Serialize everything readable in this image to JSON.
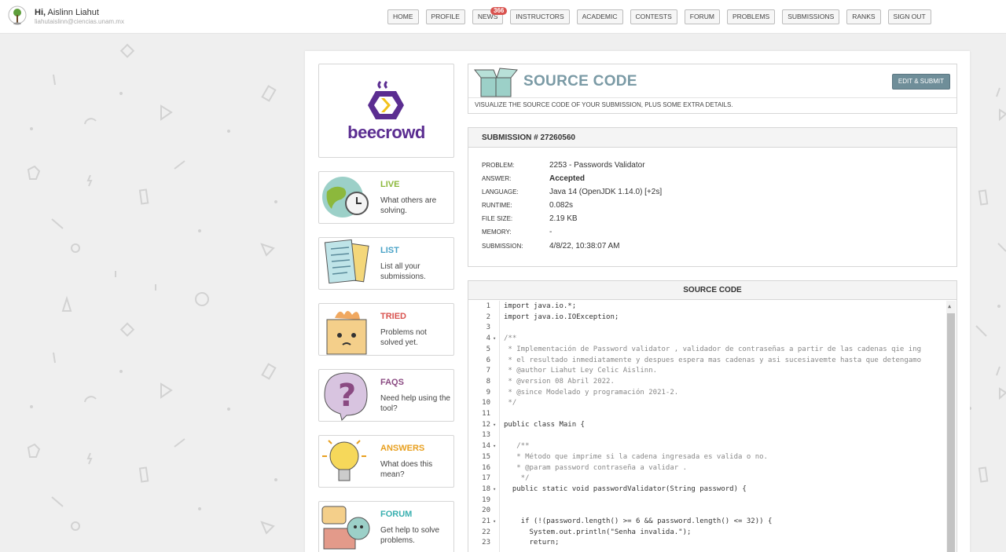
{
  "user": {
    "greeting_prefix": "Hi,",
    "name": "Aislinn Liahut",
    "email": "liahutaislinn@ciencias.unam.mx"
  },
  "nav": {
    "items": [
      "HOME",
      "PROFILE",
      "NEWS",
      "INSTRUCTORS",
      "ACADEMIC",
      "CONTESTS",
      "FORUM",
      "PROBLEMS",
      "SUBMISSIONS",
      "RANKS",
      "SIGN OUT"
    ],
    "news_badge": "366"
  },
  "logo": {
    "text": "beecrowd"
  },
  "menu": [
    {
      "title": "LIVE",
      "desc": "What others are solving.",
      "color": "#8cb83c"
    },
    {
      "title": "LIST",
      "desc": "List all your submissions.",
      "color": "#4aa3c7"
    },
    {
      "title": "TRIED",
      "desc": "Problems not solved yet.",
      "color": "#d9534f"
    },
    {
      "title": "FAQS",
      "desc": "Need help using the tool?",
      "color": "#8a4a82"
    },
    {
      "title": "ANSWERS",
      "desc": "What does this mean?",
      "color": "#e8a020"
    },
    {
      "title": "FORUM",
      "desc": "Get help to solve problems.",
      "color": "#3ab0b0"
    }
  ],
  "header": {
    "title": "SOURCE CODE",
    "subtitle": "VISUALIZE THE SOURCE CODE OF YOUR SUBMISSION, PLUS SOME EXTRA DETAILS.",
    "edit_button": "EDIT & SUBMIT"
  },
  "submission": {
    "heading": "SUBMISSION # 27260560",
    "rows": [
      {
        "label": "PROBLEM:",
        "value": "2253 - Passwords Validator"
      },
      {
        "label": "ANSWER:",
        "value": "Accepted"
      },
      {
        "label": "LANGUAGE:",
        "value": "Java 14 (OpenJDK 1.14.0) [+2s]"
      },
      {
        "label": "RUNTIME:",
        "value": "0.082s"
      },
      {
        "label": "FILE SIZE:",
        "value": "2.19 KB"
      },
      {
        "label": "MEMORY:",
        "value": "-"
      },
      {
        "label": "SUBMISSION:",
        "value": "4/8/22, 10:38:07 AM"
      }
    ]
  },
  "code": {
    "heading": "SOURCE CODE",
    "lines": [
      {
        "n": "1",
        "fold": "",
        "text": "import java.io.*;",
        "comment": false
      },
      {
        "n": "2",
        "fold": "",
        "text": "import java.io.IOException;",
        "comment": false
      },
      {
        "n": "3",
        "fold": "",
        "text": "",
        "comment": false
      },
      {
        "n": "4",
        "fold": "▾",
        "text": "/**",
        "comment": true
      },
      {
        "n": "5",
        "fold": "",
        "text": " * Implementación de Password validator , validador de contraseñas a partir de las cadenas qie ing",
        "comment": true
      },
      {
        "n": "6",
        "fold": "",
        "text": " * el resultado inmediatamente y despues espera mas cadenas y asi sucesiavemte hasta que detengamo",
        "comment": true
      },
      {
        "n": "7",
        "fold": "",
        "text": " * @author Liahut Ley Celic Aislinn.",
        "comment": true
      },
      {
        "n": "8",
        "fold": "",
        "text": " * @version 08 Abril 2022.",
        "comment": true
      },
      {
        "n": "9",
        "fold": "",
        "text": " * @since Modelado y programación 2021-2.",
        "comment": true
      },
      {
        "n": "10",
        "fold": "",
        "text": " */",
        "comment": true
      },
      {
        "n": "11",
        "fold": "",
        "text": "",
        "comment": false
      },
      {
        "n": "12",
        "fold": "▾",
        "text": "public class Main {",
        "comment": false
      },
      {
        "n": "13",
        "fold": "",
        "text": "",
        "comment": false
      },
      {
        "n": "14",
        "fold": "▾",
        "text": "   /**",
        "comment": true
      },
      {
        "n": "15",
        "fold": "",
        "text": "   * Método que imprime si la cadena ingresada es valida o no.",
        "comment": true
      },
      {
        "n": "16",
        "fold": "",
        "text": "   * @param password contraseña a validar .",
        "comment": true
      },
      {
        "n": "17",
        "fold": "",
        "text": "    */",
        "comment": true
      },
      {
        "n": "18",
        "fold": "▾",
        "text": "  public static void passwordValidator(String password) {",
        "comment": false
      },
      {
        "n": "19",
        "fold": "",
        "text": "",
        "comment": false
      },
      {
        "n": "20",
        "fold": "",
        "text": "",
        "comment": false
      },
      {
        "n": "21",
        "fold": "▾",
        "text": "    if (!(password.length() >= 6 && password.length() <= 32)) {",
        "comment": false
      },
      {
        "n": "22",
        "fold": "",
        "text": "      System.out.println(\"Senha invalida.\");",
        "comment": false
      },
      {
        "n": "23",
        "fold": "",
        "text": "      return;",
        "comment": false
      }
    ]
  }
}
